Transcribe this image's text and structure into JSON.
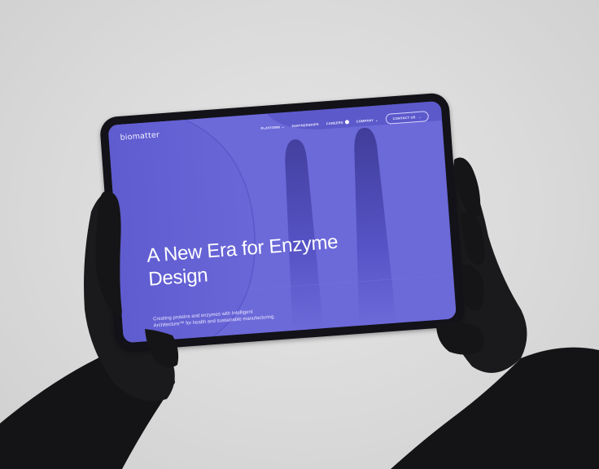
{
  "photo": {
    "background_color": "#dadada",
    "device": "tablet"
  },
  "website": {
    "logo": "biomatter",
    "nav": {
      "items": [
        {
          "label": "PLATFORM",
          "has_dropdown": true
        },
        {
          "label": "PARTNERSHIPS",
          "has_dropdown": false
        },
        {
          "label": "CAREERS",
          "has_dropdown": false
        },
        {
          "label": "COMPANY",
          "has_dropdown": true
        }
      ],
      "contact_button": "CONTACT US"
    },
    "hero": {
      "headline_line1": "A New Era for Enzyme",
      "headline_line2": "Design",
      "subtext": "Creating proteins and enzymes with Intelligent Architecture™ for health and sustainable manufacturing."
    },
    "colors": {
      "primary_purple": "#6c69d9",
      "dark_purple": "#4f4bb8",
      "text": "#ffffff"
    }
  }
}
